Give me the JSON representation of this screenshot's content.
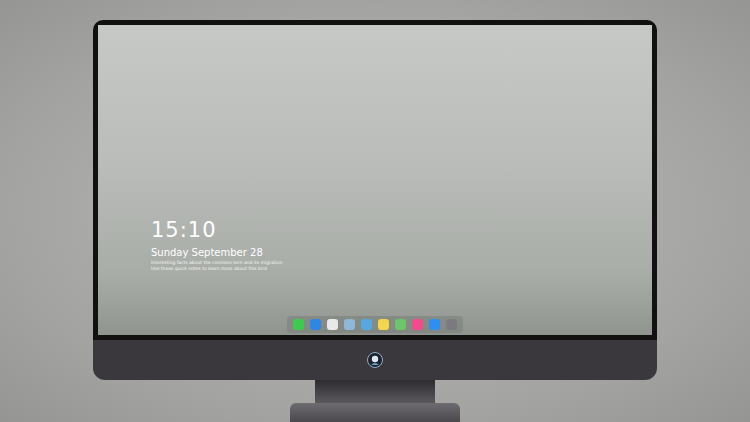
{
  "screen": {
    "kind": "lock-screen"
  },
  "clock": {
    "time": "15:10",
    "date": "Sunday September 28"
  },
  "caption": [
    "Interesting facts about the common tern and its migration",
    "Use these quick notes to learn more about this bird"
  ],
  "dock": [
    {
      "name": "messages",
      "color": "#3ec94f"
    },
    {
      "name": "finder",
      "color": "#2f86e6"
    },
    {
      "name": "safari",
      "color": "#e9e9e9"
    },
    {
      "name": "preview",
      "color": "#8fb7d8"
    },
    {
      "name": "video",
      "color": "#55a9e0"
    },
    {
      "name": "notes",
      "color": "#f5d54a"
    },
    {
      "name": "photos",
      "color": "#6cc56a"
    },
    {
      "name": "music",
      "color": "#f24a8c"
    },
    {
      "name": "app-store",
      "color": "#2d8ff0"
    },
    {
      "name": "camera",
      "color": "#7a7a80"
    }
  ]
}
